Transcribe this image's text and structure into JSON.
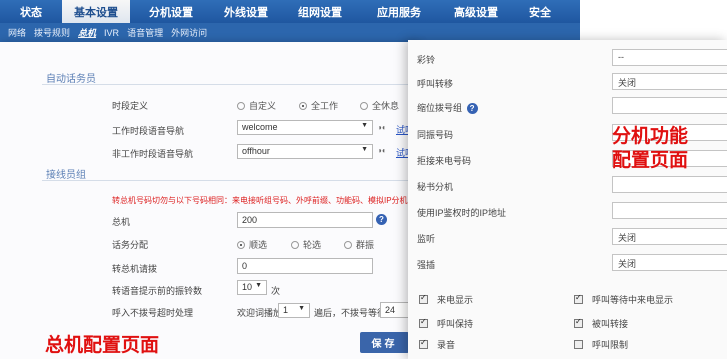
{
  "topnav": {
    "tabs": [
      {
        "label": "状态"
      },
      {
        "label": "基本设置"
      },
      {
        "label": "分机设置"
      },
      {
        "label": "外线设置"
      },
      {
        "label": "组网设置"
      },
      {
        "label": "应用服务"
      },
      {
        "label": "高级设置"
      },
      {
        "label": "安全"
      }
    ]
  },
  "subnav": {
    "items": [
      {
        "label": "网络"
      },
      {
        "label": "拨号规则"
      },
      {
        "label": "总机"
      },
      {
        "label": "IVR"
      },
      {
        "label": "语音管理"
      },
      {
        "label": "外网访问"
      }
    ]
  },
  "left": {
    "section1": "自动话务员",
    "time_label": "时段定义",
    "time_options": [
      "自定义",
      "全工作",
      "全休息"
    ],
    "work_nav_label": "工作时段语音导航",
    "work_nav_value": "welcome",
    "offwork_nav_label": "非工作时段语音导航",
    "offwork_nav_value": "offhour",
    "audition": "试听",
    "section2": "接线员组",
    "warning": "转总机号码切勿与以下号码相同：来电接听组号码、外呼前缀、功能码、模拟IP分机",
    "main_label": "总机",
    "main_value": "200",
    "dist_label": "话务分配",
    "dist_options": [
      "顺选",
      "轮选",
      "群振"
    ],
    "redial_label": "转总机请拨",
    "redial_value": "0",
    "ring_label": "转语音提示前的振铃数",
    "ring_value": "10",
    "ring_unit": "次",
    "timeout_label": "呼入不拨号超时处理",
    "timeout_prefix": "欢迎词播放",
    "timeout_count": "1",
    "timeout_suffix": "遍后，不拨号等待",
    "timeout_wait": "24",
    "save": "保存",
    "caption": "总机配置页面"
  },
  "right": {
    "rows": [
      {
        "label": "彩铃",
        "value": "--"
      },
      {
        "label": "呼叫转移",
        "value": "关闭"
      },
      {
        "label": "缩位拨号组",
        "value": ""
      },
      {
        "label": "同振号码",
        "value": ""
      },
      {
        "label": "拒接来电号码",
        "value": ""
      },
      {
        "label": "秘书分机",
        "value": ""
      },
      {
        "label": "使用IP鉴权时的IP地址",
        "value": ""
      },
      {
        "label": "监听",
        "value": "关闭"
      },
      {
        "label": "强插",
        "value": "关闭"
      }
    ],
    "checks": [
      {
        "label": "来电显示",
        "checked": true
      },
      {
        "label": "呼叫等待中来电显示",
        "checked": true
      },
      {
        "label": "呼叫保持",
        "checked": true
      },
      {
        "label": "被叫转接",
        "checked": true
      },
      {
        "label": "录音",
        "checked": true
      },
      {
        "label": "呼叫限制",
        "checked": false
      }
    ],
    "caption_line1": "分机功能",
    "caption_line2": "配置页面"
  }
}
